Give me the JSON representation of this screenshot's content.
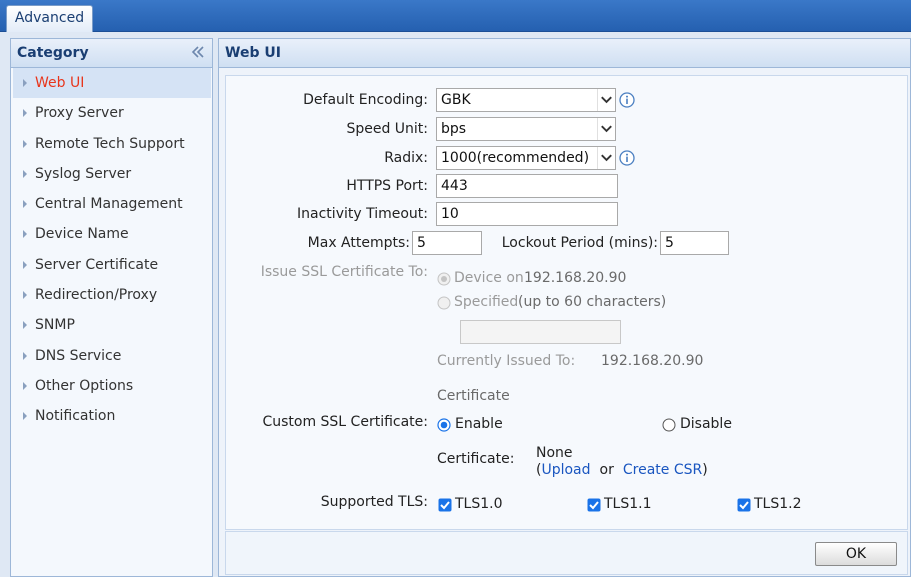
{
  "top_tab": {
    "label": "Advanced"
  },
  "sidebar": {
    "title": "Category",
    "items": [
      {
        "label": "Web UI",
        "active": true
      },
      {
        "label": "Proxy Server"
      },
      {
        "label": "Remote Tech Support"
      },
      {
        "label": "Syslog Server"
      },
      {
        "label": "Central Management"
      },
      {
        "label": "Device Name"
      },
      {
        "label": "Server Certificate"
      },
      {
        "label": "Redirection/Proxy"
      },
      {
        "label": "SNMP"
      },
      {
        "label": "DNS Service"
      },
      {
        "label": "Other Options"
      },
      {
        "label": "Notification"
      }
    ]
  },
  "main": {
    "title": "Web UI",
    "fields": {
      "default_encoding": {
        "label": "Default Encoding:",
        "value": "GBK"
      },
      "speed_unit": {
        "label": "Speed Unit:",
        "value": "bps"
      },
      "radix": {
        "label": "Radix:",
        "value": "1000(recommended)"
      },
      "https_port": {
        "label": "HTTPS Port:",
        "value": "443"
      },
      "inactivity_timeout": {
        "label": "Inactivity Timeout:",
        "value": "10"
      },
      "max_attempts": {
        "label": "Max Attempts:",
        "value": "5"
      },
      "lockout_period": {
        "label": "Lockout Period (mins):",
        "value": "5"
      }
    },
    "issue_ssl": {
      "label": "Issue SSL Certificate To:",
      "device_option": "Device on",
      "device_ip": "192.168.20.90",
      "specified_option": "Specified",
      "specified_hint": "(up to 60 characters)",
      "specified_value": "",
      "currently_issued_label": "Currently Issued To:",
      "currently_issued_value": "192.168.20.90"
    },
    "custom_ssl": {
      "section_heading": "Certificate",
      "label": "Custom SSL Certificate:",
      "enable_label": "Enable",
      "disable_label": "Disable",
      "selected": "enable",
      "certificate_label": "Certificate:",
      "certificate_value": "None",
      "open_paren": "(",
      "upload_link": "Upload",
      "or_text": "or",
      "create_csr_link": "Create CSR",
      "close_paren": ")"
    },
    "tls": {
      "label": "Supported TLS:",
      "options": [
        {
          "label": "TLS1.0",
          "checked": true
        },
        {
          "label": "TLS1.1",
          "checked": true
        },
        {
          "label": "TLS1.2",
          "checked": true
        }
      ]
    }
  },
  "footer": {
    "ok_label": "OK"
  },
  "colors": {
    "accent": "#2560b0",
    "active_item": "#e8361c",
    "link": "#1a56c0",
    "check_fill": "#1a73e8"
  }
}
